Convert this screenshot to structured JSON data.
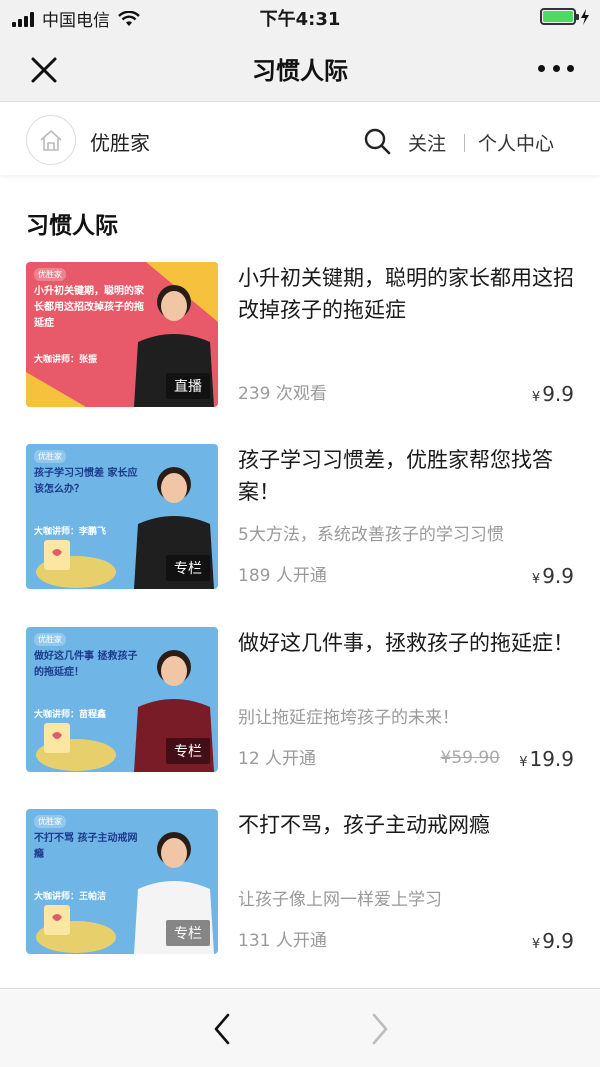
{
  "status_bar": {
    "carrier": "中国电信",
    "time": "下午4:31",
    "battery_level": 1.0,
    "battery_color": "#4cd964"
  },
  "nav": {
    "title": "习惯人际",
    "close_icon": "close-icon",
    "more_icon": "more-icon"
  },
  "shop": {
    "name": "优胜家",
    "follow_label": "关注",
    "center_label": "个人中心",
    "logo_icon": "home-icon",
    "search_icon": "search-icon"
  },
  "section": {
    "title": "习惯人际"
  },
  "courses": [
    {
      "title": "小升初关键期，聪明的家长都用这招改掉孩子的拖延症",
      "subtitle": "",
      "count": "239 次观看",
      "currency": "¥",
      "price": "9.9",
      "old_price": "",
      "tag": "直播",
      "thumb": {
        "bg": "#e85a6a",
        "accent": "#f6c23e",
        "text_color": "#ffffff",
        "logo": "优胜家",
        "lines": "小升初关键期，聪明的家长都用这招改掉孩子的拖延症",
        "teacher": "大咖讲师：张振"
      }
    },
    {
      "title": "孩子学习习惯差，优胜家帮您找答案！",
      "subtitle": "5大方法，系统改善孩子的学习习惯",
      "count": "189 人开通",
      "currency": "¥",
      "price": "9.9",
      "old_price": "",
      "tag": "专栏",
      "thumb": {
        "bg": "#6fb6e6",
        "accent": "#f4d35e",
        "text_color": "#1d3a8a",
        "logo": "优胜家",
        "lines": "孩子学习习惯差 家长应该怎么办？",
        "teacher": "大咖讲师：李鹏飞"
      }
    },
    {
      "title": "做好这几件事，拯救孩子的拖延症！",
      "subtitle": "别让拖延症拖垮孩子的未来！",
      "count": "12 人开通",
      "currency": "¥",
      "price": "19.9",
      "old_price": "¥59.90",
      "tag": "专栏",
      "thumb": {
        "bg": "#6fb6e6",
        "accent": "#f4d35e",
        "text_color": "#1d3a8a",
        "logo": "优胜家",
        "lines": "做好这几件事 拯救孩子的拖延症！",
        "teacher": "大咖讲师：苗程鑫"
      }
    },
    {
      "title": "不打不骂，孩子主动戒网瘾",
      "subtitle": "让孩子像上网一样爱上学习",
      "count": "131 人开通",
      "currency": "¥",
      "price": "9.9",
      "old_price": "",
      "tag": "专栏",
      "thumb": {
        "bg": "#6fb6e6",
        "accent": "#f4d35e",
        "text_color": "#1d3a8a",
        "logo": "优胜家",
        "lines": "不打不骂 孩子主动戒网瘾",
        "teacher": "大咖讲师：王帕洁"
      }
    }
  ],
  "toolbar": {
    "back_icon": "back-arrow-icon",
    "forward_icon": "forward-arrow-icon"
  }
}
